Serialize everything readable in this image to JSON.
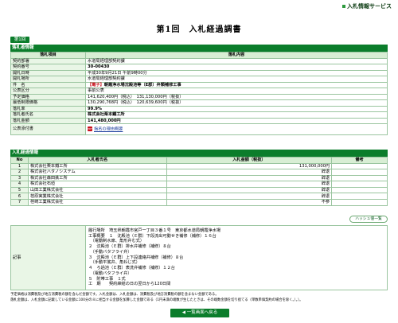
{
  "header": {
    "service_label": "入札情報サービス",
    "title": "第1回　入札経過調書",
    "round_tab": "第1回"
  },
  "info": {
    "section_title": "落札者情報",
    "col_item": "落札項目",
    "col_content": "落札内容",
    "rows": [
      {
        "label": "契約部署",
        "value": "水道局経理部契約課"
      },
      {
        "label": "契約番号",
        "value": "30-00430"
      },
      {
        "label": "開札日時",
        "value": "平成30年9月21日 午前9時00分"
      },
      {
        "label": "開札場所",
        "value": "水道局経理部契約課"
      },
      {
        "label": "件　名",
        "value_prefix": "【電子】",
        "value": "朝霞浄水場沈殿池等（E郡）弁類補修工事"
      },
      {
        "label": "公表区分",
        "value": "事前公表"
      },
      {
        "label": "予定価格",
        "value": "141,620,400円（税込）　131,130,000円（税抜）"
      },
      {
        "label": "最低制限価格",
        "value": "130,290,768円（税込）　120,639,600円（税抜）"
      },
      {
        "label": "落札率",
        "value": "99.9%"
      },
      {
        "label": "落札者氏名",
        "value": "株式会社栗本鐵工所"
      },
      {
        "label": "落札金額",
        "value": "141,480,000円"
      },
      {
        "label": "公表添付書",
        "value": "指名の理由概要"
      }
    ]
  },
  "bids": {
    "section_title": "入札経過情報",
    "headers": {
      "no": "No",
      "name": "入札者氏名",
      "amount": "入札金額（税抜）",
      "note": "備考"
    },
    "rows": [
      {
        "no": "1",
        "name": "株式会社栗本鐵工所",
        "amount": "131,000,000円",
        "note": ""
      },
      {
        "no": "2",
        "name": "株式会社ハタノシステム",
        "amount": "辞退",
        "note": ""
      },
      {
        "no": "3",
        "name": "株式会社森田鉄工所",
        "amount": "辞退",
        "note": ""
      },
      {
        "no": "4",
        "name": "株式会社石垣",
        "amount": "辞退",
        "note": ""
      },
      {
        "no": "5",
        "name": "山田工業株式会社",
        "amount": "辞退",
        "note": ""
      },
      {
        "no": "6",
        "name": "荏原実業株式会社",
        "amount": "辞退",
        "note": ""
      },
      {
        "no": "7",
        "name": "荏崎工業株式会社",
        "amount": "不参",
        "note": ""
      }
    ],
    "hash_button": "ハッシュ値一覧"
  },
  "remarks": {
    "label": "記事",
    "text": "履行場所　埼玉県朝霞市宮戸一丁目３番１号　東京都水道局朝霞浄水場\n工事概要　１　沈殿池（Ｅ群）下段流出可動せき補修（補修）１６台\n　（電動制水扉、角形弁む式）\n２　沈殿池（Ｅ群）排水弁補修（補修）８台\n　（手動バタフライ弁）\n３　沈殿池（Ｅ群）上下段連絡弁補修（補修）８台\n　（手動平底弁、角ねじ式）\n４　ろ過池（Ｅ群）表洗弁補修（補修）１２台\n　（電動バタフライ弁）\n５　附帯工事　１式\n工　期　　契約締結の日の翌日から120日間"
  },
  "footnotes": {
    "line1": "予定価格は消費税及び地方消費税の額を含んだ金額です。入札金額は、入札金額は、消費税及び地方消費税の額を含まない金額である。",
    "line2": "落札金額は、入札金額に記載している金額に100分の８に相当する金額を加算した金額である（1円未満の端数が生じたときは、その端数金額を切り捨てる（単数単価契約の場合を除く。）。）。"
  },
  "nav": {
    "back_button": "一覧画面へ戻る"
  },
  "colors": {
    "accent": "#0b7d2b",
    "header_cell": "#d8eed4",
    "label_cell": "#e9f6e6",
    "alert": "#c8101c"
  }
}
